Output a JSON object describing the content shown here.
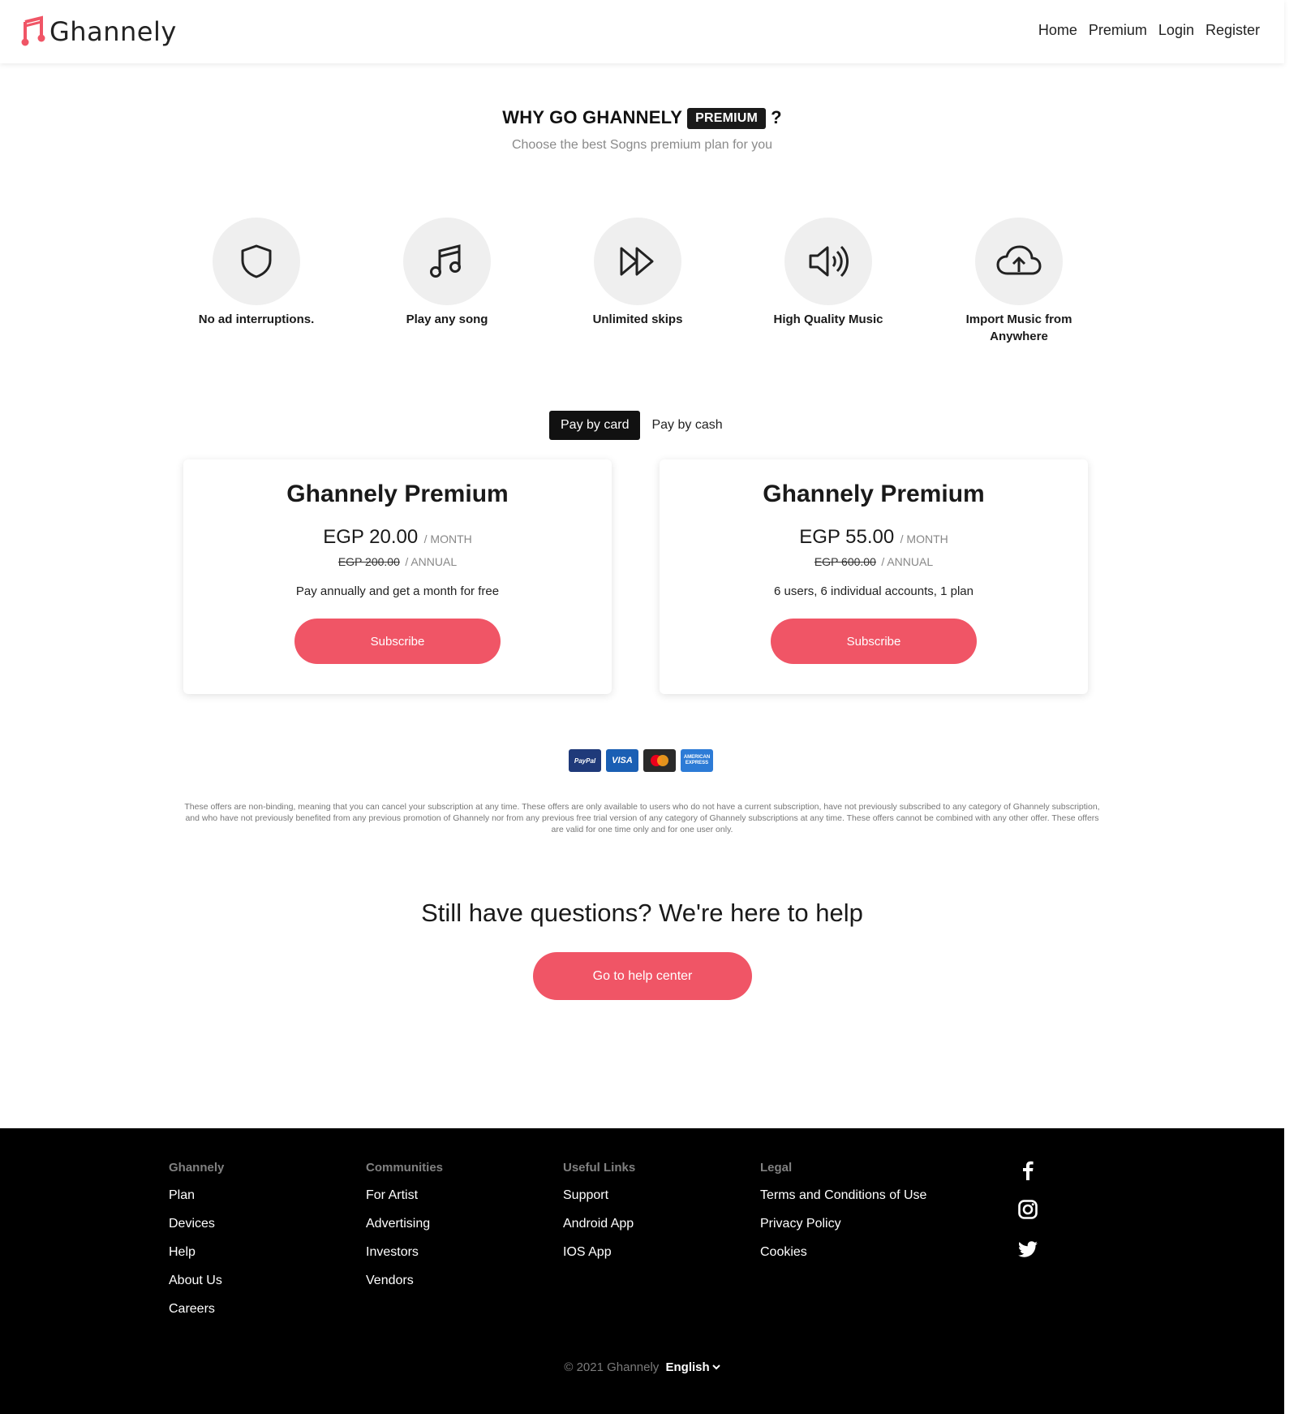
{
  "header": {
    "brand": "Ghannely",
    "nav": [
      "Home",
      "Premium",
      "Login",
      "Register"
    ]
  },
  "why": {
    "title": "WHY GO GHANNELY",
    "badge": "PREMIUM",
    "question": "?",
    "subtitle": "Choose the best Sogns premium plan for you"
  },
  "features": [
    {
      "icon": "shield-icon",
      "label": "No ad interruptions."
    },
    {
      "icon": "music-note-icon",
      "label": "Play any song"
    },
    {
      "icon": "fast-forward-icon",
      "label": "Unlimited skips"
    },
    {
      "icon": "speaker-icon",
      "label": "High Quality Music"
    },
    {
      "icon": "cloud-upload-icon",
      "label": "Import Music from Anywhere"
    }
  ],
  "payment_tabs": [
    {
      "label": "Pay by card",
      "active": true
    },
    {
      "label": "Pay by cash",
      "active": false
    }
  ],
  "plans": [
    {
      "name": "Ghannely Premium",
      "price": "EGP 20.00",
      "per": "/ MONTH",
      "annual": "EGP 200.00",
      "annual_per": "/ ANNUAL",
      "description": "Pay annually and get a month for free",
      "button": "Subscribe"
    },
    {
      "name": "Ghannely Premium",
      "price": "EGP 55.00",
      "per": "/ MONTH",
      "annual": "EGP 600.00",
      "annual_per": "/ ANNUAL",
      "description": "6 users, 6 individual accounts, 1 plan",
      "button": "Subscribe"
    }
  ],
  "payment_methods": {
    "paypal": "PayPal",
    "visa": "VISA",
    "amex": "AMERICAN EXPRESS"
  },
  "disclaimer": "These offers are non-binding, meaning that you can cancel your subscription at any time. These offers are only available to users who do not have a current subscription, have not previously subscribed to any category of Ghannely subscription, and who have not previously benefited from any previous promotion of Ghannely nor from any previous free trial version of any category of Ghannely subscriptions at any time. These offers cannot be combined with any other offer. These offers are valid for one time only and for one user only.",
  "help": {
    "title": "Still have questions? We're here to help",
    "button": "Go to help center"
  },
  "footer": {
    "columns": [
      {
        "heading": "Ghannely",
        "links": [
          "Plan",
          "Devices",
          "Help",
          "About Us",
          "Careers"
        ]
      },
      {
        "heading": "Communities",
        "links": [
          "For Artist",
          "Advertising",
          "Investors",
          "Vendors"
        ]
      },
      {
        "heading": "Useful Links",
        "links": [
          "Support",
          "Android App",
          "IOS App"
        ]
      },
      {
        "heading": "Legal",
        "links": [
          "Terms and Conditions of Use",
          "Privacy Policy",
          "Cookies"
        ]
      }
    ],
    "social": [
      "facebook-icon",
      "instagram-icon",
      "twitter-icon"
    ],
    "copyright": "© 2021 Ghannely",
    "language": "English"
  },
  "colors": {
    "accent": "#f05566",
    "dark": "#111111",
    "footer_bg": "#000000"
  }
}
